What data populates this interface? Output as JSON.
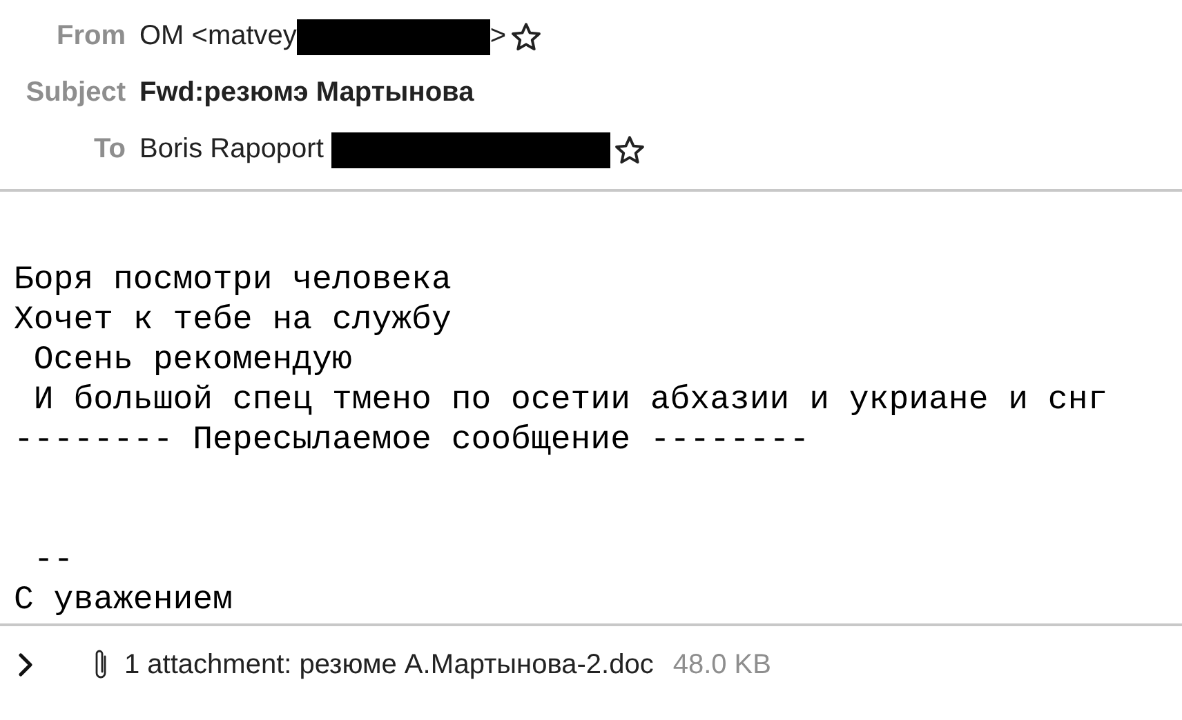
{
  "header": {
    "fields": [
      {
        "label": "From",
        "value": "OM <matvey",
        "after": ">",
        "redacted": true,
        "starred": false,
        "kind": "address"
      },
      {
        "label": "Subject",
        "value": "Fwd:резюмэ Мартынова",
        "kind": "subject"
      },
      {
        "label": "To",
        "value": "Boris Rapoport",
        "redacted": true,
        "starred": false,
        "kind": "address"
      }
    ]
  },
  "body": {
    "blocks": [
      {
        "lines": [
          "Боря посмотри человека",
          "Хочет к тебе на службу",
          " Осень рекомендую",
          " И большой спец тмено по осетии абхазии и укриане и снг",
          "-------- Пересылаемое сообщение --------"
        ]
      },
      {
        "lines": [
          " --",
          "С уважением"
        ]
      }
    ]
  },
  "attachments": {
    "expanded": false,
    "summary": "1 attachment: резюме А.Мартынова-2.doc",
    "size": "48.0 KB"
  }
}
